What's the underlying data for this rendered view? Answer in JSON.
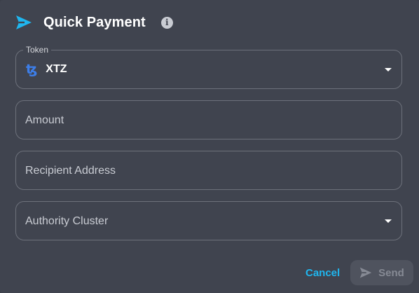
{
  "dialog": {
    "title": "Quick Payment",
    "title_icon": "send-icon",
    "info_icon": "info-icon"
  },
  "fields": {
    "token": {
      "label": "Token",
      "value": "XTZ",
      "icon": "tezos-icon",
      "icon_glyph": "ꜩ"
    },
    "amount": {
      "placeholder": "Amount"
    },
    "recipient": {
      "placeholder": "Recipient Address"
    },
    "authority": {
      "placeholder": "Authority Cluster"
    }
  },
  "actions": {
    "cancel_label": "Cancel",
    "send_label": "Send"
  },
  "colors": {
    "background": "#40444f",
    "accent": "#1fb6ef",
    "border": "#6d717b",
    "tezos": "#3d7ee8",
    "disabled_button": "#4f535e"
  }
}
